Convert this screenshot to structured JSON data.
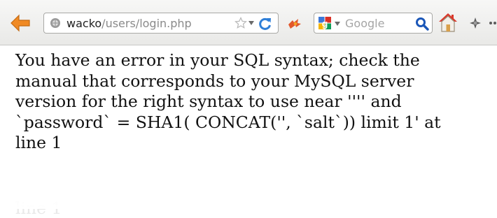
{
  "browser": {
    "url_host": "wacko",
    "url_path": "/users/login.php",
    "search_placeholder": "Google",
    "icons": {
      "back": "back-arrow-icon",
      "site": "site-identity-icon",
      "bookmark": "bookmark-star-icon",
      "history_dropdown": "chevron-down-icon",
      "reload": "reload-icon",
      "addon": "addon-icon",
      "search_engine": "google-icon",
      "search_go": "magnifier-icon",
      "home": "home-icon",
      "extension": "extension-icon"
    },
    "colors": {
      "back_arrow": "#f08a24",
      "reload": "#2f7fd8",
      "home_roof": "#d9392b",
      "magnifier": "#1b57b8"
    }
  },
  "page": {
    "error_lines": [
      "You have an error in your SQL syntax; check the",
      "manual that corresponds to your MySQL server",
      "version for the right syntax to use near '''' and",
      "`password` = SHA1( CONCAT('', `salt`)) limit 1' at",
      "line 1"
    ],
    "reflection_text": "line 1"
  }
}
